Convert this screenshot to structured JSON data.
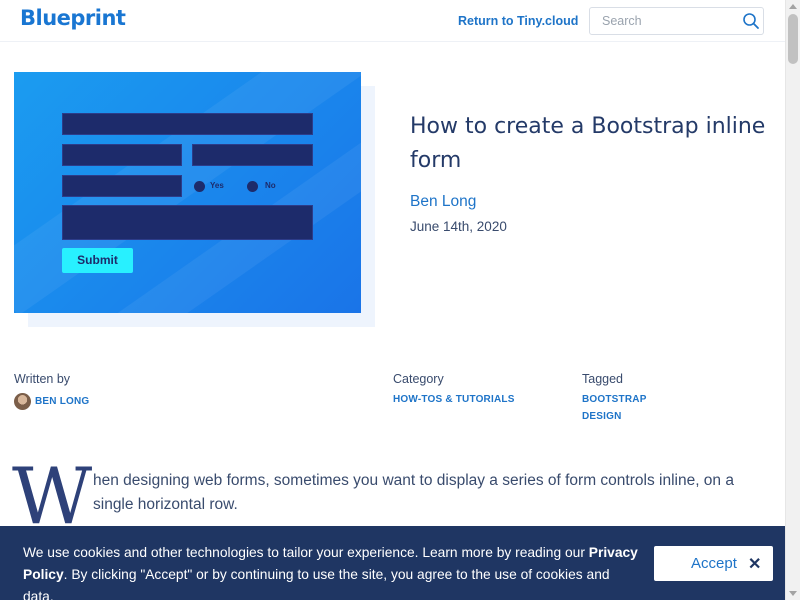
{
  "header": {
    "logo": "Blueprint",
    "return_link": "Return to Tiny.cloud",
    "search_placeholder": "Search"
  },
  "hero": {
    "mock_radio_yes": "Yes",
    "mock_radio_no": "No",
    "mock_submit": "Submit"
  },
  "post": {
    "title": "How to create a Bootstrap inline form",
    "author": "Ben Long",
    "date": "June 14th, 2020"
  },
  "meta": {
    "written_by_label": "Written by",
    "author_tag": "BEN LONG",
    "category_label": "Category",
    "category": "HOW-TOS & TUTORIALS",
    "tagged_label": "Tagged",
    "tags": [
      "BOOTSTRAP",
      "DESIGN"
    ]
  },
  "intro": {
    "dropcap": "W",
    "text": "hen designing web forms, sometimes you want to display a series of form controls inline, on a single horizontal row."
  },
  "cookie": {
    "text_before": "We use cookies and other technologies to tailor your experience. Learn more by reading our ",
    "privacy_link": "Privacy Policy",
    "text_after": ". By clicking \"Accept\" or by continuing to use the site, you agree to the use of cookies and data.",
    "accept_label": "Accept",
    "close_glyph": "✕"
  },
  "colors": {
    "brand": "#1976d2",
    "link": "#1e74c8",
    "title": "#243a68",
    "cookie_bg": "#1f3663"
  }
}
